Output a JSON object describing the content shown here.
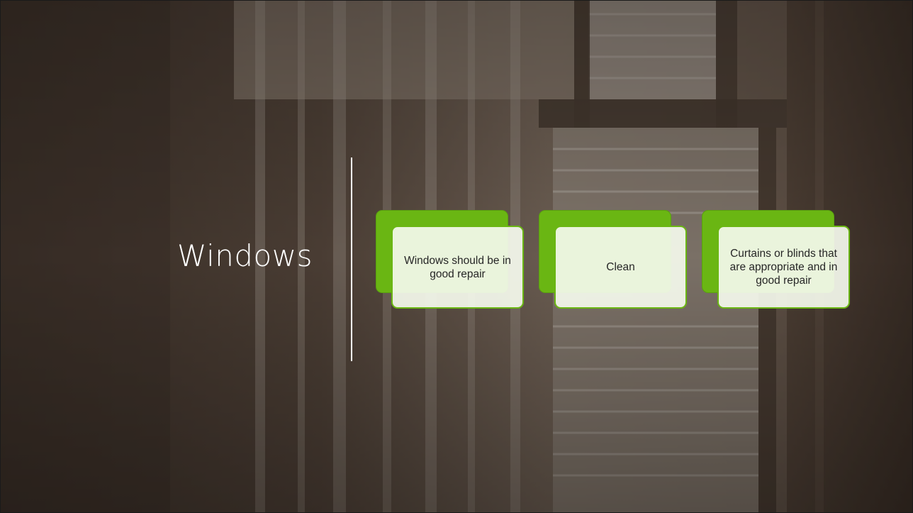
{
  "slide": {
    "title": "Windows",
    "cards": [
      {
        "text": "Windows should be in good repair"
      },
      {
        "text": "Clean"
      },
      {
        "text": "Curtains or blinds that are appropriate and in good repair"
      }
    ]
  },
  "colors": {
    "accent": "#6ab613",
    "card_fill": "#f4f9ec",
    "title_text": "#ffffff",
    "card_text": "#262626"
  },
  "background": {
    "description_icon": "window-curtain-photo"
  }
}
